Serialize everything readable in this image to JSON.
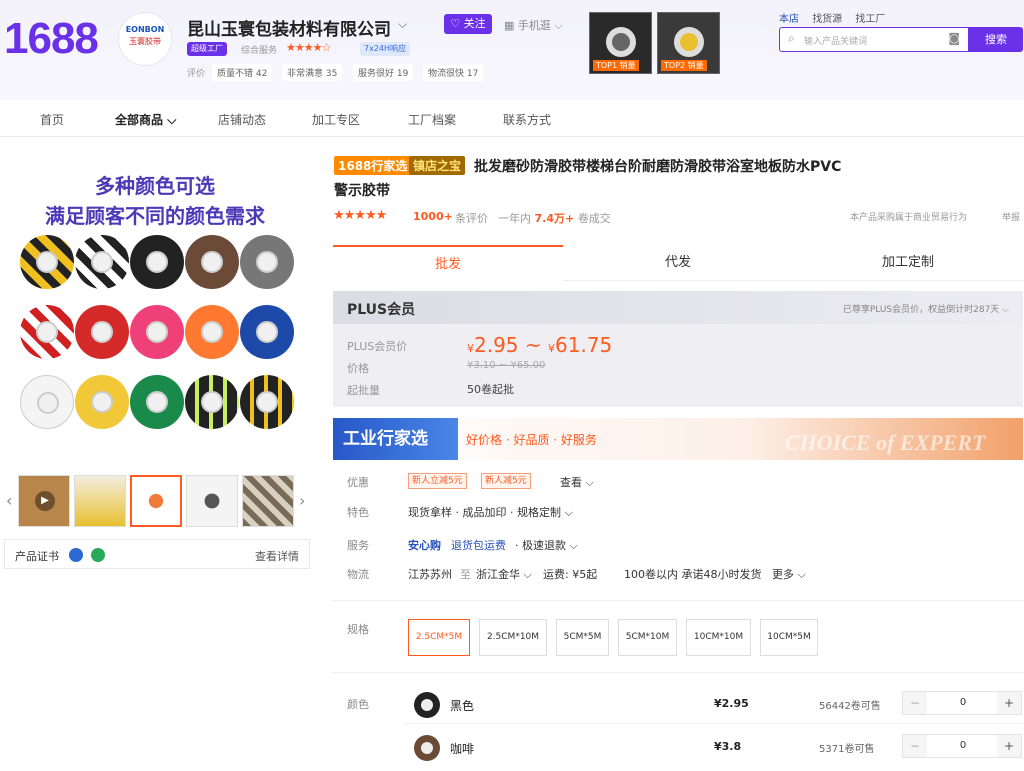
{
  "brand": {
    "logo": "1688"
  },
  "shop": {
    "logo_line1": "EONBON",
    "logo_line2": "玉寰胶带",
    "name": "昆山玉寰包装材料有限公司",
    "follow": "关注",
    "mobile": "手机逛",
    "badge": "超级工厂",
    "service_label": "综合服务",
    "rating_stars": "★★★★☆",
    "badge2": "7x24H响应",
    "reviews_label": "评价",
    "reviews": [
      "质量不错 42",
      "非常满意 35",
      "服务很好 19",
      "物流很快 17"
    ]
  },
  "top_images": [
    {
      "tag": "TOP1 销量"
    },
    {
      "tag": "TOP2 销量"
    }
  ],
  "header_links": [
    "本店",
    "找货源",
    "找工厂"
  ],
  "search": {
    "placeholder": "输入产品关键词",
    "button": "搜索"
  },
  "nav": [
    "首页",
    "全部商品",
    "店铺动态",
    "加工专区",
    "工厂档案",
    "联系方式"
  ],
  "banner": {
    "line1": "多种颜色可选",
    "line2": "满足顾客不同的颜色需求"
  },
  "cert": {
    "label": "产品证书",
    "link": "查看详情"
  },
  "product": {
    "tag1": "1688行家选",
    "tag2": "镇店之宝",
    "title1": "批发磨砂防滑胶带楼梯台阶耐磨防滑胶带浴室地板防水PVC",
    "title2": "警示胶带",
    "stars": "★★★★★",
    "review_count": "1000+",
    "review_label": "条评价",
    "sales_prefix": "一年内",
    "sales_value": "7.4万+",
    "sales_suffix": "卷成交",
    "note": "本产品采购属于商业贸易行为",
    "report": "举报"
  },
  "tabs": [
    "批发",
    "代发",
    "加工定制"
  ],
  "plus": {
    "title": "PLUS会员",
    "note": "已尊享PLUS会员价，权益倒计时287天",
    "price_label": "PLUS会员价",
    "price_low": "2.95",
    "price_high": "61.75",
    "currency": "¥",
    "tilde": "~",
    "orig_label": "价格",
    "orig_price": "¥3.10 ~ ¥65.00",
    "min_label": "起批量",
    "min_value": "50卷起批"
  },
  "expert": {
    "title": "工业行家选",
    "slogan": "好价格 · 好品质 · 好服务",
    "bg_text": "CHOICE of EXPERT"
  },
  "rows": {
    "offer_label": "优惠",
    "coupons": [
      "新人立减5元",
      "新人减5元"
    ],
    "offer_more": "查看",
    "feature_label": "特色",
    "features": "现货拿样 · 成品加印 · 规格定制",
    "service_label": "服务",
    "service_a": "安心购",
    "service_b": "退货包运费",
    "service_c": "· 极速退款",
    "logistics_label": "物流",
    "from": "江苏苏州",
    "to_word": "至",
    "to": "浙江金华",
    "fee": "运费: ¥5起",
    "ship": "100卷以内 承诺48小时发货",
    "more": "更多"
  },
  "spec": {
    "label": "规格",
    "options": [
      "2.5CM*5M",
      "2.5CM*10M",
      "5CM*5M",
      "5CM*10M",
      "10CM*10M",
      "10CM*5M"
    ]
  },
  "colors": {
    "label": "颜色",
    "items": [
      {
        "name": "黑色",
        "price": "¥2.95",
        "stock": "56442卷可售",
        "qty": "0",
        "color": "#222"
      },
      {
        "name": "咖啡",
        "price": "¥3.8",
        "stock": "5371卷可售",
        "qty": "0",
        "color": "#6b4a38"
      }
    ]
  }
}
